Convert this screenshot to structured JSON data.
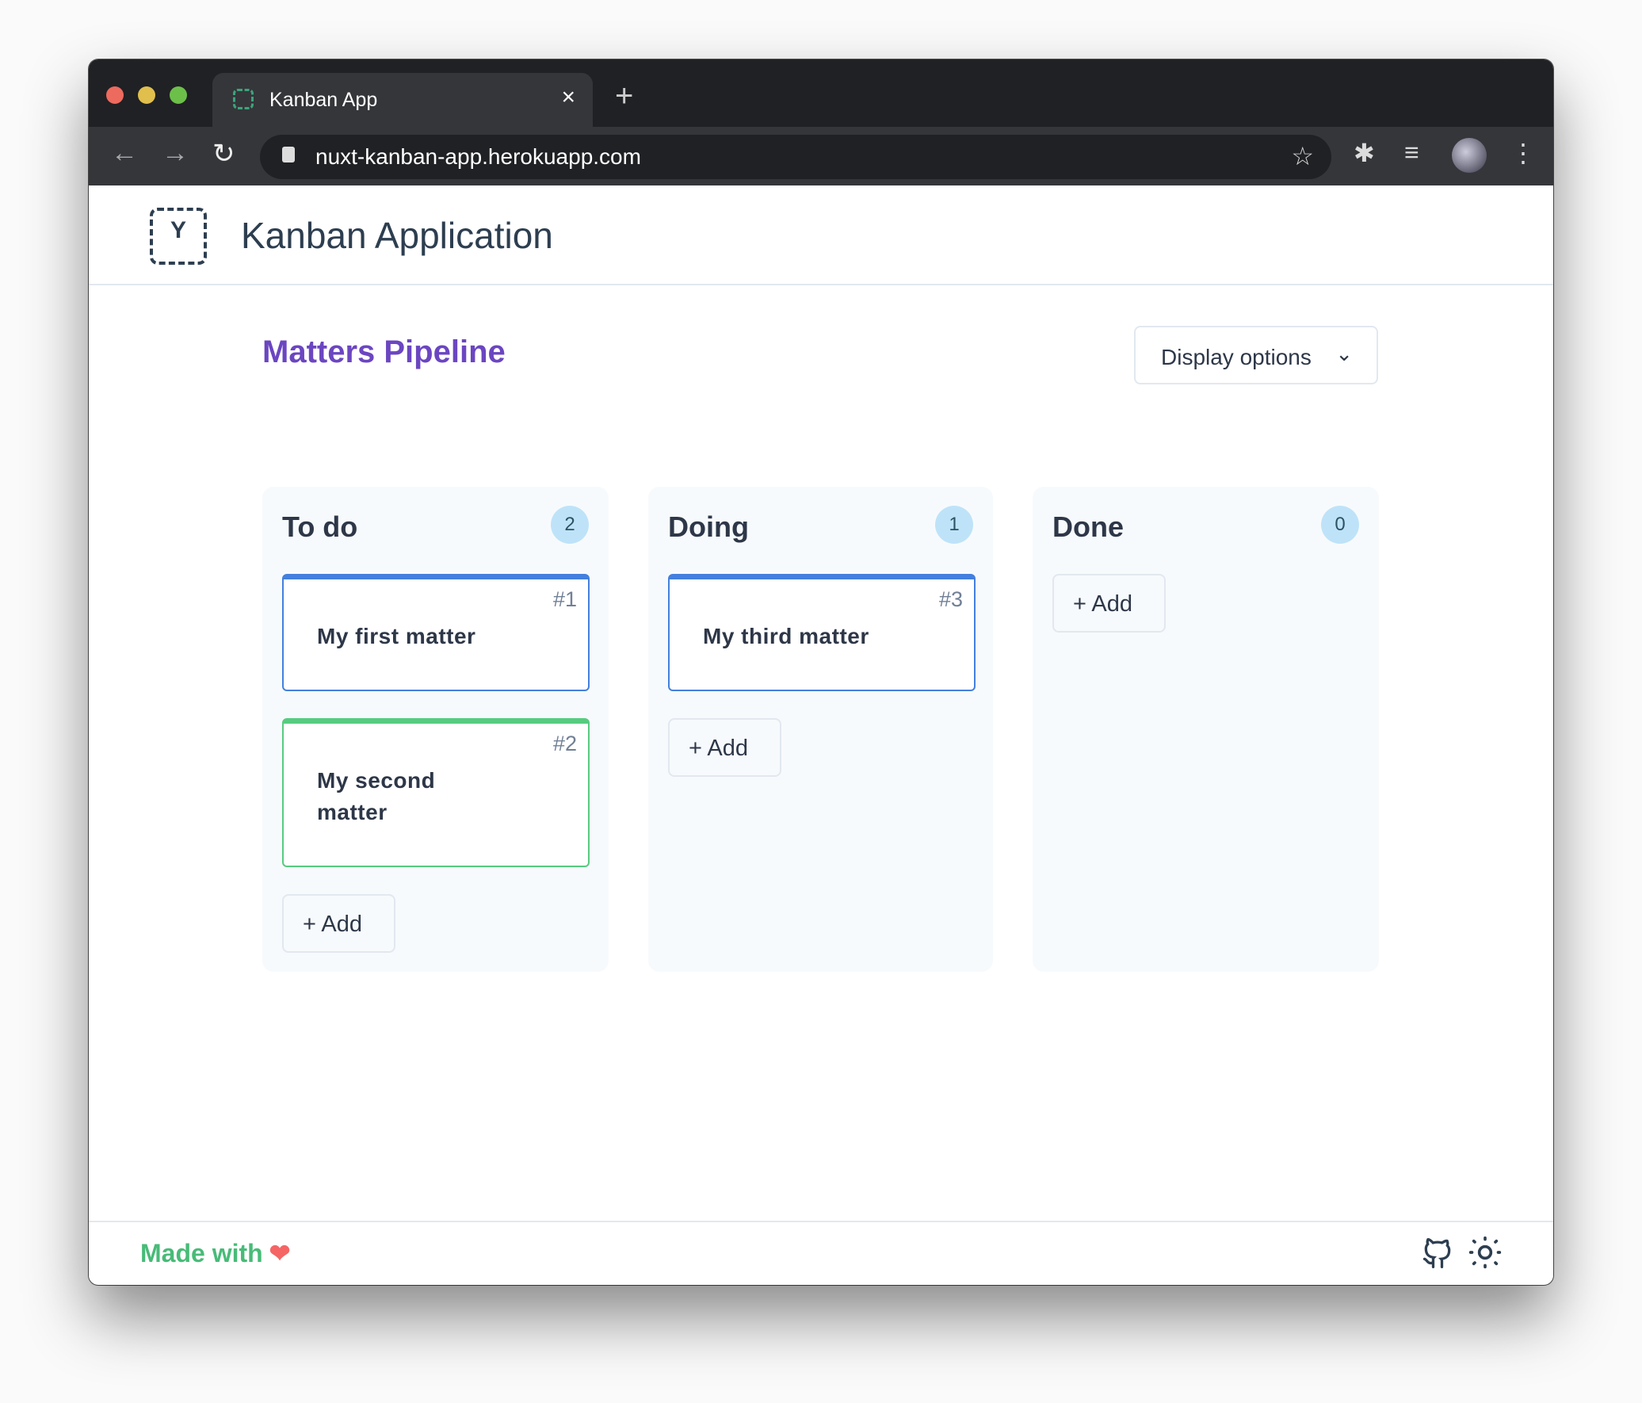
{
  "browser": {
    "tab_title": "Kanban App",
    "url": "nuxt-kanban-app.herokuapp.com"
  },
  "app": {
    "title": "Kanban Application"
  },
  "board": {
    "title": "Matters Pipeline",
    "display_options": "Display options",
    "columns": [
      {
        "title": "To do",
        "count": "2",
        "cards": [
          {
            "id": "#1",
            "title": "My first matter",
            "color": "#4380de"
          },
          {
            "id": "#2",
            "title": "My second matter",
            "color": "#56cc80"
          }
        ]
      },
      {
        "title": "Doing",
        "count": "1",
        "cards": [
          {
            "id": "#3",
            "title": "My third matter",
            "color": "#4380de"
          }
        ]
      },
      {
        "title": "Done",
        "count": "0",
        "cards": []
      }
    ],
    "add_label": "+ Add"
  },
  "footer": {
    "made_with": "Made with"
  }
}
